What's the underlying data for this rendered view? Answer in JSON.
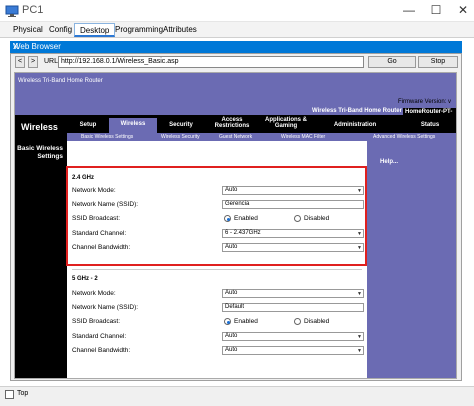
{
  "window": {
    "title": "PC1",
    "minimize": "—",
    "maximize": "☐",
    "close": "✕"
  },
  "tabs": [
    {
      "label": "Physical"
    },
    {
      "label": "Config"
    },
    {
      "label": "Desktop"
    },
    {
      "label": "Programming"
    },
    {
      "label": "Attributes"
    }
  ],
  "browser": {
    "title": "Web Browser",
    "close": "X",
    "back": "<",
    "forward": ">",
    "url_label": "URL",
    "url": "http://192.168.0.1/Wireless_Basic.asp",
    "go": "Go",
    "stop": "Stop"
  },
  "router": {
    "banner_title": "Wireless Tri-Band Home Router",
    "firmware": "Firmware Version: v",
    "right_name": "Wireless Tri-Band Home Router",
    "model": "HomeRouter-PT-",
    "section": "Wireless",
    "menu": [
      "Setup",
      "Wireless",
      "Security",
      "Access Restrictions",
      "Applications & Gaming",
      "Administration",
      "Status"
    ],
    "submenu": [
      "Basic Wireless Settings",
      "Wireless Security",
      "Guest Network",
      "Wireless MAC Filter",
      "Advanced Wireless Settings"
    ],
    "left_title": "Basic Wireless Settings",
    "help": "Help..."
  },
  "band24": {
    "title": "2.4 GHz",
    "network_mode_label": "Network Mode:",
    "network_mode": "Auto",
    "ssid_label": "Network Name (SSID):",
    "ssid": "Gerencia",
    "broadcast_label": "SSID Broadcast:",
    "enabled": "Enabled",
    "disabled": "Disabled",
    "channel_label": "Standard Channel:",
    "channel": "6 - 2.437GHz",
    "bandwidth_label": "Channel Bandwidth:",
    "bandwidth": "Auto"
  },
  "band5": {
    "title": "5 GHz - 2",
    "network_mode_label": "Network Mode:",
    "network_mode": "Auto",
    "ssid_label": "Network Name (SSID):",
    "ssid": "Default",
    "broadcast_label": "SSID Broadcast:",
    "enabled": "Enabled",
    "disabled": "Disabled",
    "channel_label": "Standard Channel:",
    "channel": "Auto",
    "bandwidth_label": "Channel Bandwidth:",
    "bandwidth": "Auto"
  },
  "footer": {
    "top_label": "Top"
  },
  "colors": {
    "accent": "#6b6bb3",
    "highlight": "#e0201f",
    "titlebar": "#0078d7"
  }
}
